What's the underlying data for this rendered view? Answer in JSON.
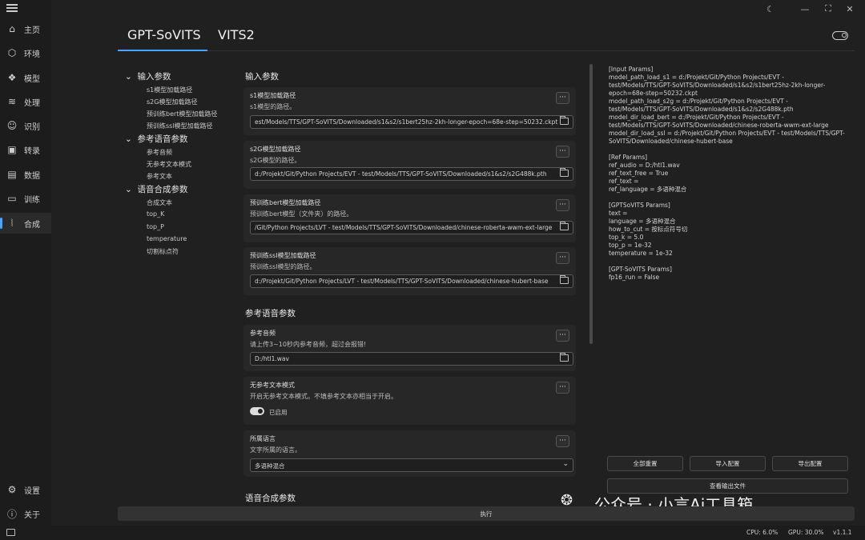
{
  "window": {
    "theme_icon": "moon-icon",
    "minimize_icon": "minimize-icon",
    "maximize_icon": "maximize-icon",
    "close_icon": "close-icon"
  },
  "sidebar": {
    "menu_icon": "hamburger-icon",
    "items": [
      {
        "label": "主页",
        "icon": "home-icon"
      },
      {
        "label": "环境",
        "icon": "cube-icon"
      },
      {
        "label": "模型",
        "icon": "model-icon"
      },
      {
        "label": "处理",
        "icon": "waveform-icon"
      },
      {
        "label": "识别",
        "icon": "user-recognize-icon"
      },
      {
        "label": "转录",
        "icon": "transcribe-icon"
      },
      {
        "label": "数据",
        "icon": "data-icon"
      },
      {
        "label": "训练",
        "icon": "train-icon"
      },
      {
        "label": "合成",
        "icon": "synth-icon"
      }
    ],
    "bottom": [
      {
        "label": "设置",
        "icon": "gear-icon"
      },
      {
        "label": "关于",
        "icon": "info-icon"
      }
    ]
  },
  "tabs": [
    {
      "label": "GPT-SoVITS"
    },
    {
      "label": "VITS2"
    }
  ],
  "tree": {
    "groups": [
      {
        "label": "输入参数",
        "children": [
          "s1模型加载路径",
          "s2G模型加载路径",
          "预训练bert模型加载路径",
          "预训练ssl模型加载路径"
        ]
      },
      {
        "label": "参考语音参数",
        "children": [
          "参考音频",
          "无参考文本模式",
          "参考文本"
        ]
      },
      {
        "label": "语音合成参数",
        "children": [
          "合成文本",
          "top_K",
          "top_P",
          "temperature",
          "切割标点符"
        ]
      }
    ]
  },
  "main": {
    "input_title": "输入参数",
    "s1": {
      "title": "s1模型加载路径",
      "desc": "s1模型的路径。",
      "value": "est/Models/TTS/GPT-SoVITS/Downloaded/s1&s2/s1bert25hz-2kh-longer-epoch=68e-step=50232.ckpt"
    },
    "s2": {
      "title": "s2G模型加载路径",
      "desc": "s2G模型的路径。",
      "value": "d:/Projekt/Git/Python Projects/EVT - test/Models/TTS/GPT-SoVITS/Downloaded/s1&s2/s2G488k.pth"
    },
    "bert": {
      "title": "预训练bert模型加载路径",
      "desc": "预训练bert模型（文件夹）的路径。",
      "value": "/Git/Python Projects/LVT - test/Models/TTS/GPT-SoVITS/Downloaded/chinese-roberta-wwm-ext-large"
    },
    "ssl": {
      "title": "预训练ssl模型加载路径",
      "desc": "预训练ssl模型的路径。",
      "value": "d:/Projekt/Git/Python Projects/LVT - test/Models/TTS/GPT-SoVITS/Downloaded/chinese-hubert-base"
    },
    "ref_title": "参考语音参数",
    "ref_audio": {
      "title": "参考音频",
      "desc": "请上传3~10秒内参考音频，超过会报错!",
      "value": "D:/htl1.wav"
    },
    "no_ref": {
      "title": "无参考文本模式",
      "desc": "开启无参考文本模式。不填参考文本亦相当于开启。",
      "toggle_label": "已启用"
    },
    "lang": {
      "title": "所属语言",
      "desc": "文字所属的语言。",
      "value": "多语种混合"
    },
    "synth_title": "语音合成参数"
  },
  "output": {
    "text": "[Input Params]\nmodel_path_load_s1 = d:/Projekt/Git/Python Projects/EVT - test/Models/TTS/GPT-SoVITS/Downloaded/s1&s2/s1bert25hz-2kh-longer-epoch=68e-step=50232.ckpt\nmodel_path_load_s2g = d:/Projekt/Git/Python Projects/EVT - test/Models/TTS/GPT-SoVITS/Downloaded/s1&s2/s2G488k.pth\nmodel_dir_load_bert = d:/Projekt/Git/Python Projects/EVT - test/Models/TTS/GPT-SoVITS/Downloaded/chinese-roberta-wwm-ext-large\nmodel_dir_load_ssl = d:/Projekt/Git/Python Projects/EVT - test/Models/TTS/GPT-SoVITS/Downloaded/chinese-hubert-base\n\n[Ref Params]\nref_audio = D:/htl1.wav\nref_text_free = True\nref_text =\nref_language = 多语种混合\n\n[GPTSoVITS Params]\ntext =\nlanguage = 多语种混合\nhow_to_cut = 按标点符号切\ntop_k = 5.0\ntop_p = 1e-32\ntemperature = 1e-32\n\n[GPT-SoVITS Params]\nfp16_run = False",
    "reset_all": "全部重置",
    "import_config": "导入配置",
    "export_config": "导出配置",
    "view_output": "查看输出文件"
  },
  "run_label": "执行",
  "watermark": "公众号 · 小言Ai工具箱",
  "status": {
    "cpu": "CPU: 6.0%",
    "gpu": "GPU: 30.0%",
    "version": "v1.1.1"
  },
  "colors": {
    "accent": "#4aa3ff",
    "background": "#202020"
  }
}
